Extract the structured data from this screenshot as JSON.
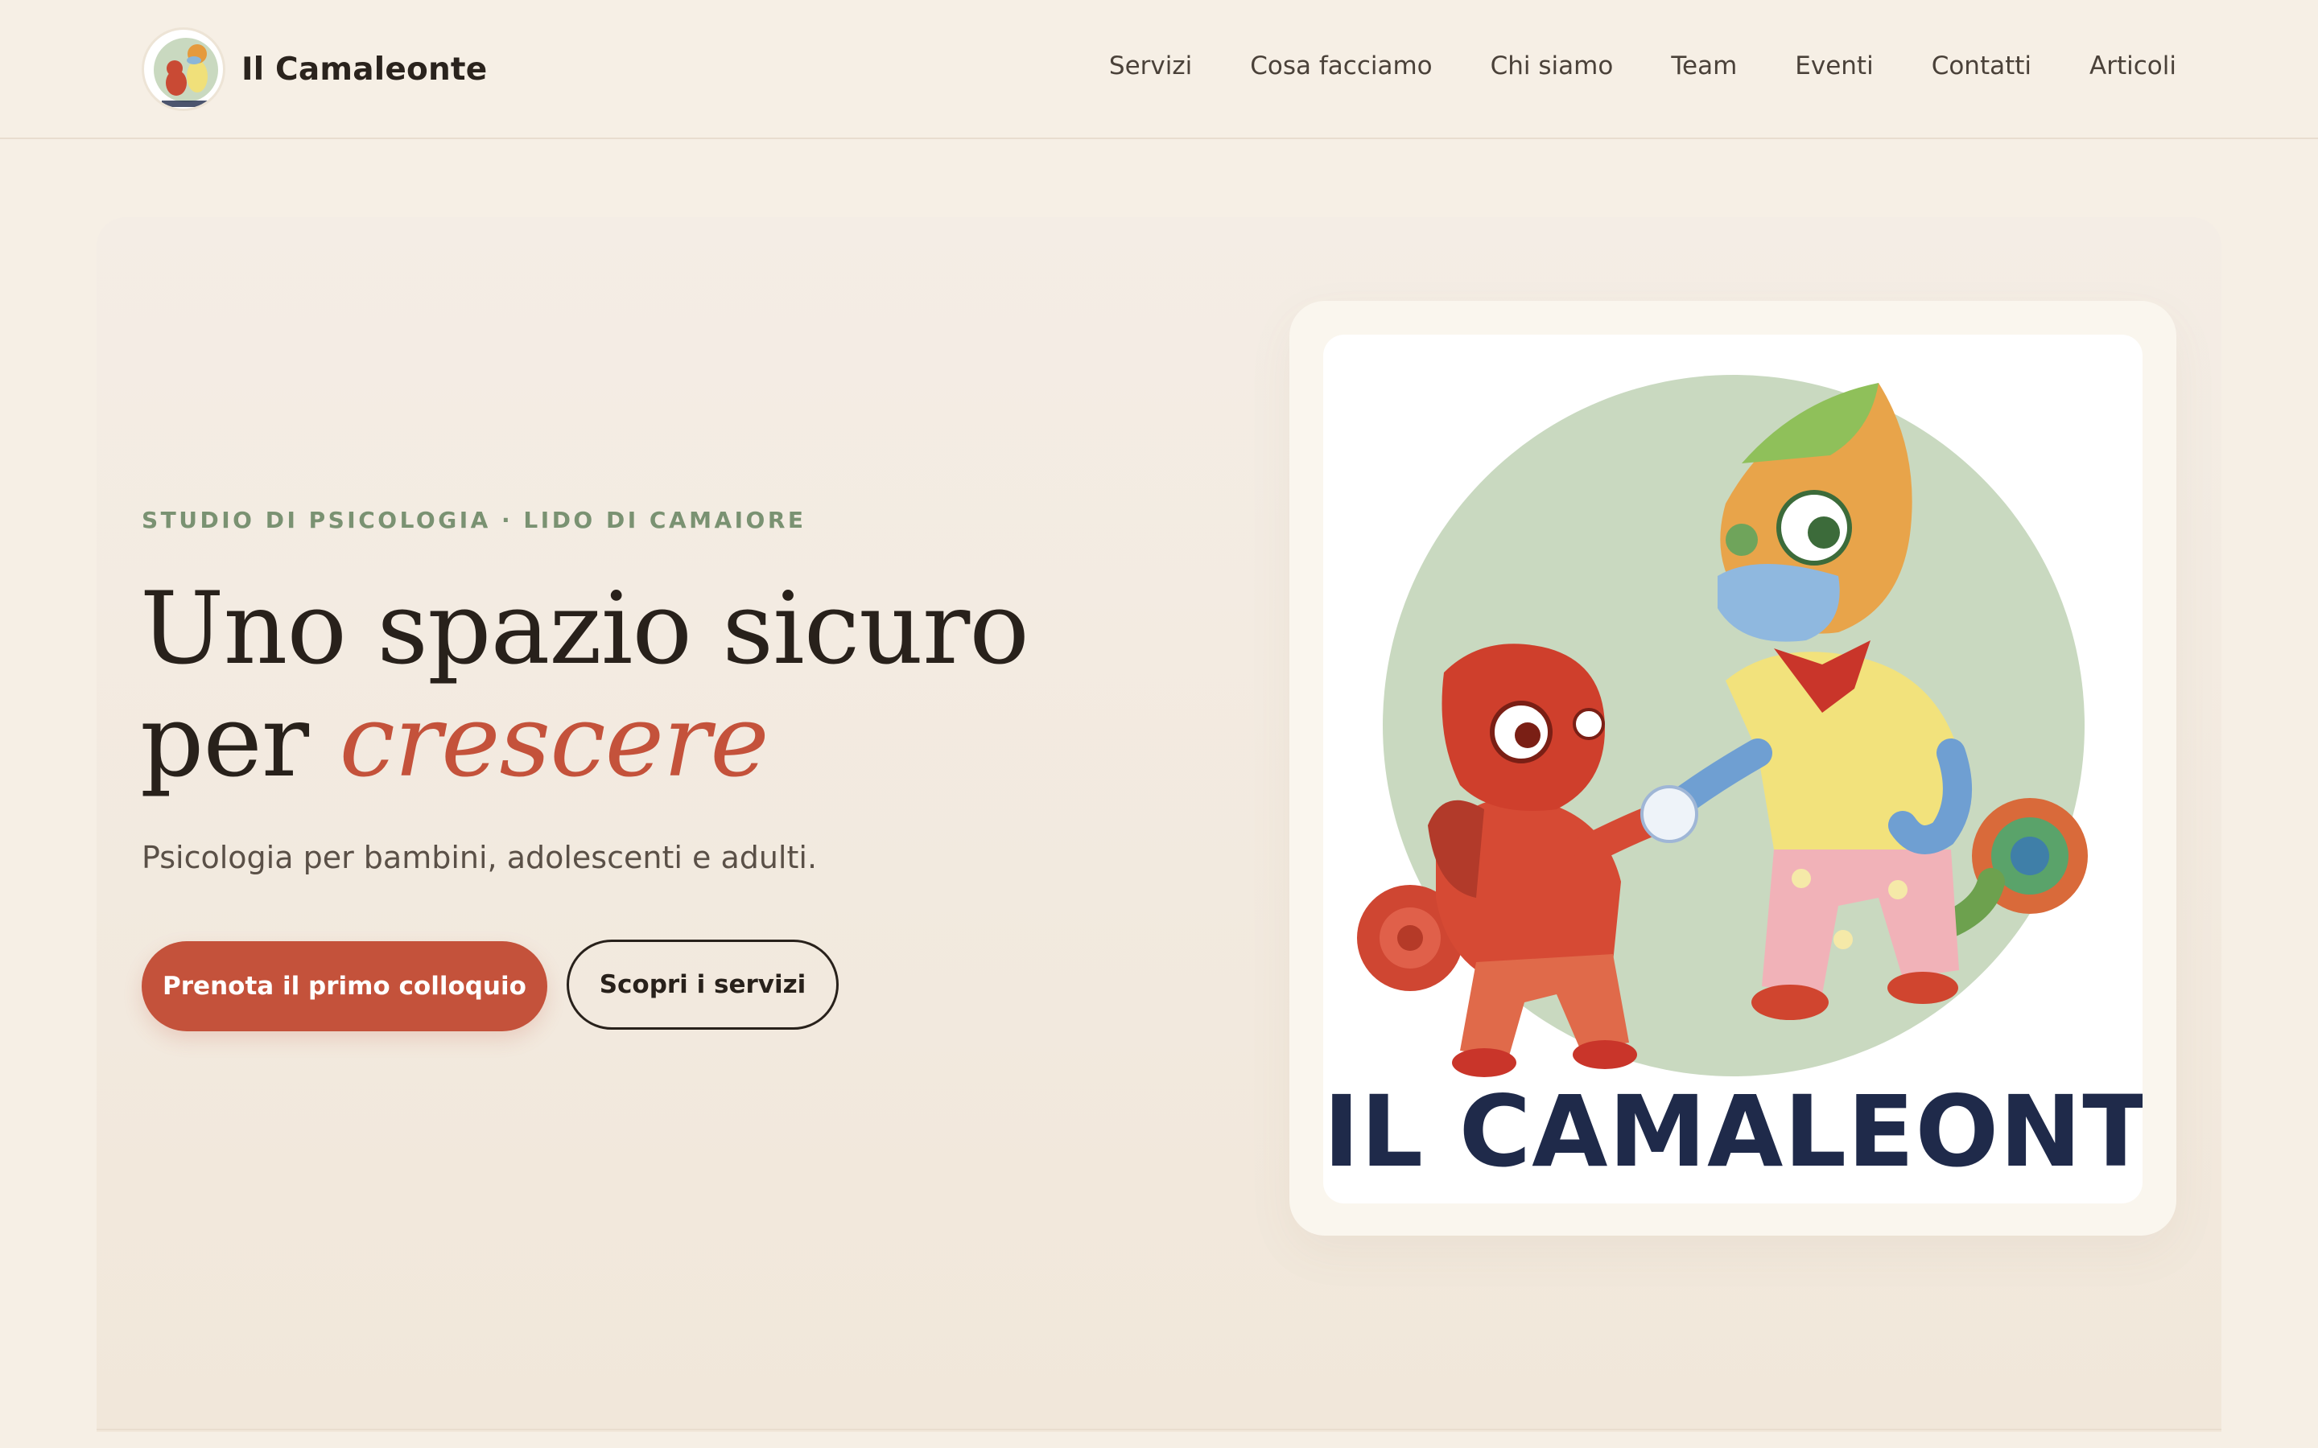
{
  "brand": {
    "name": "Il Camaleonte",
    "logo_alt": "Il Camaleonte logo"
  },
  "nav": {
    "items": [
      "Servizi",
      "Cosa facciamo",
      "Chi siamo",
      "Team",
      "Eventi",
      "Contatti",
      "Articoli"
    ]
  },
  "hero": {
    "eyebrow": "STUDIO DI PSICOLOGIA · LIDO DI CAMAIORE",
    "headline_line1": "Uno spazio sicuro",
    "headline_line2_prefix": "per ",
    "headline_accent": "crescere",
    "subtitle": "Psicologia per bambini, adolescenti e adulti.",
    "primary_cta": "Prenota il primo colloquio",
    "secondary_cta": "Scopri i servizi"
  },
  "illustration": {
    "logo_text": "IL CAMALEONTE",
    "circle_color": "#c9d9c0"
  },
  "colors": {
    "background": "#f6efe5",
    "accent": "#c4523b",
    "eyebrow": "#7a9272",
    "text_dark": "#28211b",
    "logo_navy": "#1f2a4a"
  }
}
